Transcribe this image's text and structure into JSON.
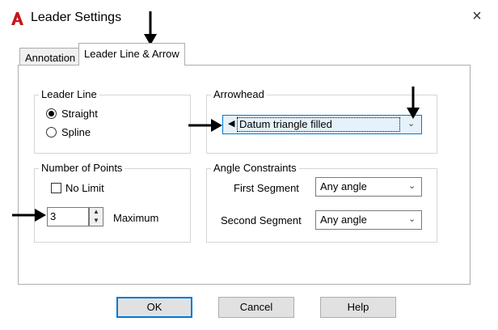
{
  "window": {
    "title": "Leader Settings",
    "close_glyph": "×",
    "app_icon": "autocad-a-icon",
    "accent_color": "#c4161c"
  },
  "tabs": [
    {
      "label": "Annotation",
      "selected": false
    },
    {
      "label": "Leader Line & Arrow",
      "selected": true
    }
  ],
  "leader_line": {
    "legend": "Leader Line",
    "options": [
      {
        "label": "Straight",
        "selected": true
      },
      {
        "label": "Spline",
        "selected": false
      }
    ]
  },
  "arrowhead": {
    "legend": "Arrowhead",
    "selected": "Datum triangle filled",
    "glyph": "◀"
  },
  "number_of_points": {
    "legend": "Number of Points",
    "no_limit_label": "No Limit",
    "no_limit_checked": false,
    "value": "3",
    "maximum_label": "Maximum"
  },
  "angle_constraints": {
    "legend": "Angle Constraints",
    "first_label": "First Segment",
    "first_value": "Any angle",
    "second_label": "Second Segment",
    "second_value": "Any angle"
  },
  "buttons": {
    "ok": "OK",
    "cancel": "Cancel",
    "help": "Help"
  }
}
